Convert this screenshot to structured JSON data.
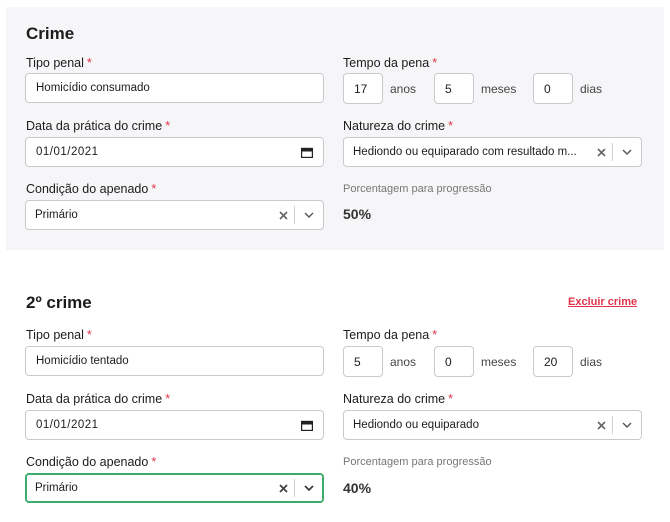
{
  "crimes": [
    {
      "title": "Crime",
      "tipo_penal_label": "Tipo penal",
      "tipo_penal_value": "Homicídio consumado",
      "tempo_label": "Tempo da pena",
      "anos": "17",
      "anos_label": "anos",
      "meses": "5",
      "meses_label": "meses",
      "dias": "0",
      "dias_label": "dias",
      "data_label": "Data da prática do crime",
      "data_value": "01/01/2021",
      "natureza_label": "Natureza do crime",
      "natureza_value": "Hediondo ou equiparado com resultado m...",
      "condicao_label": "Condição do apenado",
      "condicao_value": "Primário",
      "porcentagem_label": "Porcentagem para progressão",
      "porcentagem_value": "50%"
    },
    {
      "title": "2º crime",
      "excluir_label": "Excluir crime",
      "tipo_penal_label": "Tipo penal",
      "tipo_penal_value": "Homicídio tentado",
      "tempo_label": "Tempo da pena",
      "anos": "5",
      "anos_label": "anos",
      "meses": "0",
      "meses_label": "meses",
      "dias": "20",
      "dias_label": "dias",
      "data_label": "Data da prática do crime",
      "data_value": "01/01/2021",
      "natureza_label": "Natureza do crime",
      "natureza_value": "Hediondo ou equiparado",
      "condicao_label": "Condição do apenado",
      "condicao_value": "Primário",
      "porcentagem_label": "Porcentagem para progressão",
      "porcentagem_value": "40%"
    }
  ],
  "required_marker": "*",
  "colors": {
    "required": "#e0344b",
    "focus": "#3dac6a",
    "card_bg": "#f6f6f8"
  },
  "icons": {
    "date": "calendar-icon",
    "clear": "close-icon",
    "expand": "chevron-down-icon"
  }
}
